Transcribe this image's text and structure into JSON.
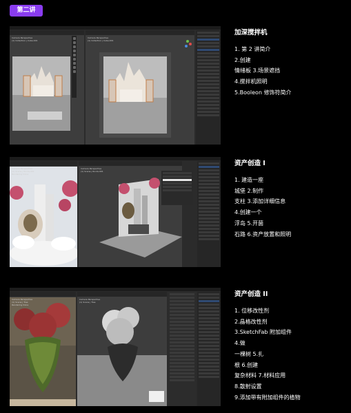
{
  "badge": "第二讲",
  "sections": [
    {
      "title": "加深搅拌机",
      "lines": [
        "1. 第 2 讲简介",
        "2.创建",
        "情绪板 3.场景遮挡",
        "4.搅拌机照明",
        "5.Booleon 修饰符简介"
      ],
      "viewport_overlay": [
        "Camera Perspective",
        "(1) Collection | Cube.001"
      ]
    },
    {
      "title": "资产创造 I",
      "lines": [
        "1. 建造一座",
        "城堡 2.制作",
        "支柱 3.添加详细信息",
        "4.创建一个",
        "浮岛 5.开菌",
        "石路 6.资产放置和照明"
      ],
      "viewport_overlay": [
        "Camera Perspective",
        "(1) Scene | Rocks.001",
        "Rendering Done"
      ]
    },
    {
      "title": "资产创造 II",
      "lines": [
        "1. 位移改性剂",
        "2.晶格改性剂",
        "3.SketchFab 附加组件",
        "4.做",
        "一棵树 5.扎",
        "根 6.创建",
        "复杂材料 7.材料应用",
        "8.散射设置",
        "9.添加带有附加组件的植物"
      ],
      "viewport_overlay": [
        "Camera Perspective",
        "(1) Scene | Tree",
        "Rendering Done"
      ]
    }
  ],
  "colors": {
    "badge": "#8a3cf0",
    "background": "#000000",
    "blender_panel": "#262626",
    "blender_viewport": "#3d3d3d"
  }
}
